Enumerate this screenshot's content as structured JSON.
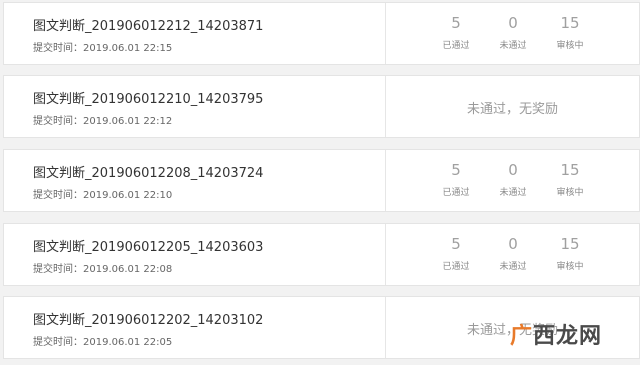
{
  "items": [
    {
      "title": "图文判断_201906012212_14203871",
      "time": "提交时间：2019.06.01 22:15",
      "passed": "5",
      "failed": "0",
      "reviewing": "15"
    },
    {
      "title": "图文判断_201906012210_14203795",
      "time": "提交时间：2019.06.01 22:12",
      "status": "未通过，无奖励"
    },
    {
      "title": "图文判断_201906012208_14203724",
      "time": "提交时间：2019.06.01 22:10",
      "passed": "5",
      "failed": "0",
      "reviewing": "15"
    },
    {
      "title": "图文判断_201906012205_14203603",
      "time": "提交时间：2019.06.01 22:08",
      "passed": "5",
      "failed": "0",
      "reviewing": "15"
    },
    {
      "title": "图文判断_201906012202_14203102",
      "time": "提交时间：2019.06.01 22:05",
      "status": "未通过，无奖励"
    }
  ],
  "labels": {
    "passed": "已通过",
    "failed": "未通过",
    "reviewing": "审核中"
  },
  "watermark": {
    "first": "广",
    "rest": "西龙网"
  }
}
